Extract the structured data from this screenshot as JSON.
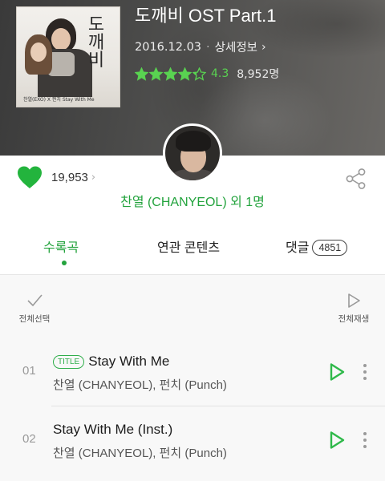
{
  "album": {
    "title": "도깨비 OST Part.1",
    "release_date": "2016.12.03",
    "detail_link": "상세정보",
    "rating": "4.3",
    "rating_stars": 4.3,
    "rating_count": "8,952명",
    "cover_title_text": "도깨비",
    "cover_credit_text": "찬열(EXO) X 펀치  Stay With Me"
  },
  "likes": {
    "count": "19,953"
  },
  "artist_line": "찬열 (CHANYEOL) 외 1명",
  "tabs": [
    {
      "label": "수록곡",
      "active": true
    },
    {
      "label": "연관 콘텐츠",
      "active": false
    },
    {
      "label": "댓글",
      "badge": "4851",
      "active": false
    }
  ],
  "controls": {
    "select_all": "전체선택",
    "play_all": "전체재생"
  },
  "tracks": [
    {
      "number": "01",
      "badge": "TITLE",
      "title": "Stay With Me",
      "artist": "찬열 (CHANYEOL), 펀치 (Punch)"
    },
    {
      "number": "02",
      "badge": "",
      "title": "Stay With Me (Inst.)",
      "artist": "찬열 (CHANYEOL), 펀치 (Punch)"
    }
  ],
  "colors": {
    "accent_green": "#23a33d",
    "rating_green": "#59d351",
    "header_bg": "#4a4a49"
  },
  "icons": [
    "heart-icon",
    "share-icon",
    "checkmark-icon",
    "play-outline-icon",
    "play-icon",
    "more-vertical-icon",
    "star-icon",
    "chevron-right-icon"
  ]
}
